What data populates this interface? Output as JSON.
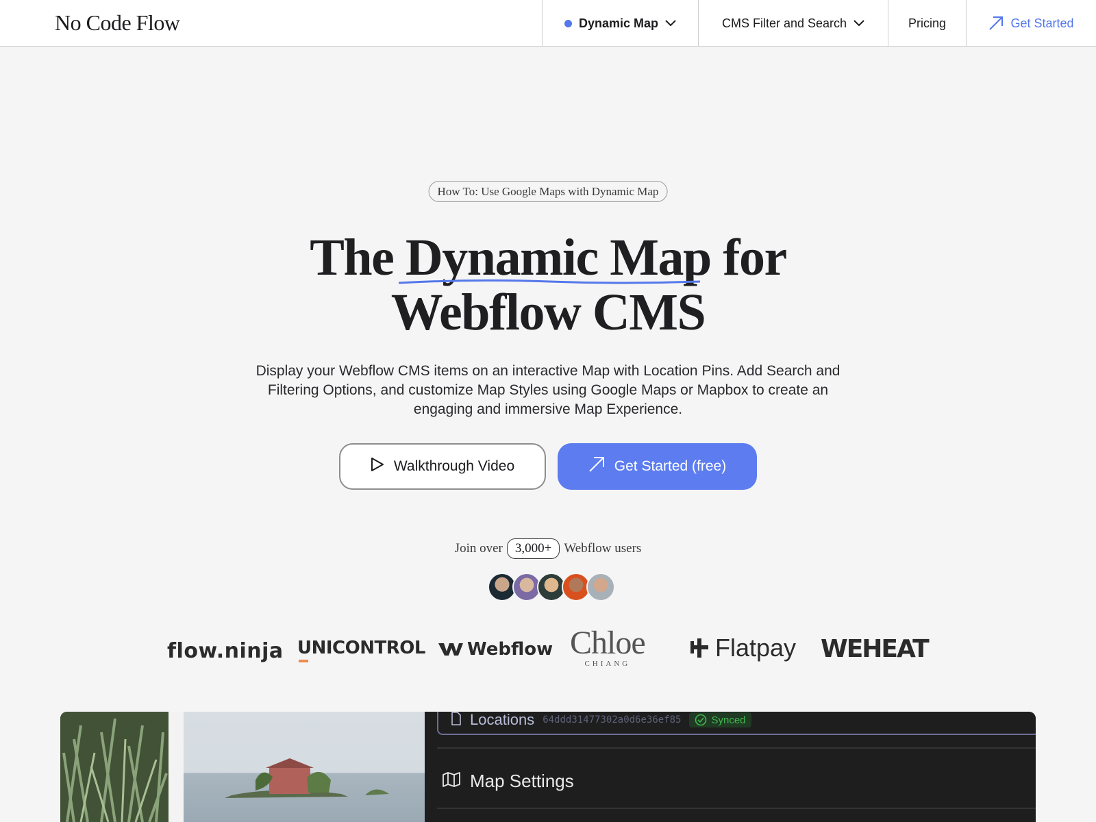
{
  "header": {
    "logo": "No Code Flow",
    "nav": {
      "dynamic_map": "Dynamic Map",
      "cms_filter": "CMS Filter and Search",
      "pricing": "Pricing",
      "get_started": "Get Started"
    }
  },
  "hero": {
    "pill": "How To: Use Google Maps with Dynamic Map",
    "headline_pre": "The ",
    "headline_highlight": "Dynamic Map",
    "headline_post": " for",
    "headline_line2": "Webflow CMS",
    "subtitle": "Display your Webflow CMS items on an interactive Map with Location Pins. Add Search and Filtering Options, and customize Map Styles using Google Maps or Mapbox to create an engaging and immersive Map Experience.",
    "btn_video": "Walkthrough Video",
    "btn_start": "Get Started (free)"
  },
  "social": {
    "join_pre": "Join over",
    "count": "3,000+",
    "join_post": "Webflow users"
  },
  "logos": {
    "flow_ninja": "flow.ninja",
    "unicontrol": "UNICONTROL",
    "webflow": "Webflow",
    "chloe": "Chloe",
    "chloe_sub": "CHIANG",
    "flatpay": "Flatpay",
    "weheat": "WEHEAT"
  },
  "preview": {
    "collection": "Locations",
    "collection_id": "64ddd31477302a0d6e36ef85",
    "status": "Synced",
    "section": "Map Settings"
  },
  "colors": {
    "accent": "#5c7cf0",
    "background": "#f5f5f5",
    "synced_green": "#41b84d"
  }
}
